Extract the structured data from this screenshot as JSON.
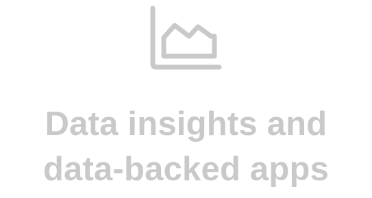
{
  "feature": {
    "icon": "area-chart-icon",
    "line1": "Data insights and",
    "line2": "data-backed apps",
    "color": "#c9c9c9"
  }
}
